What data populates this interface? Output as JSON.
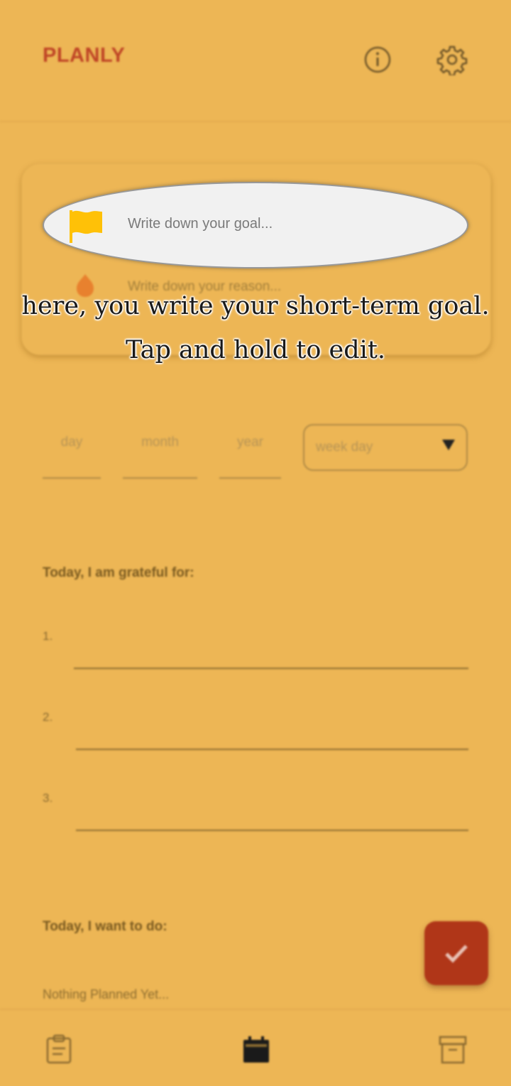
{
  "app": {
    "brand": "PLANLY"
  },
  "header": {
    "icons": [
      "info-icon",
      "gear-icon"
    ]
  },
  "goal": {
    "placeholder": "Write down your goal...",
    "icon": "flag-icon",
    "icon_color": "#FFC107"
  },
  "reason": {
    "placeholder": "Write down your reason...",
    "icon": "flame-icon"
  },
  "date": {
    "day_placeholder": "day",
    "month_placeholder": "month",
    "year_placeholder": "year",
    "weekday_placeholder": "week day"
  },
  "gratitude": {
    "title": "Today, I am grateful for:",
    "items": [
      "1.",
      "2.",
      "3."
    ]
  },
  "todo": {
    "title": "Today, I want to do:",
    "empty_text": "Nothing Planned Yet..."
  },
  "fab": {
    "icon": "check-icon",
    "color": "#B03618"
  },
  "bottom_nav": {
    "icons": [
      "clipboard-icon",
      "calendar-icon",
      "archive-icon"
    ]
  },
  "tutorial": {
    "line1": "here, you write your short-term goal.",
    "line2": "Tap and hold to edit."
  },
  "colors": {
    "background": "#EDB655",
    "brand": "#BF4526",
    "accent": "#B03618"
  }
}
